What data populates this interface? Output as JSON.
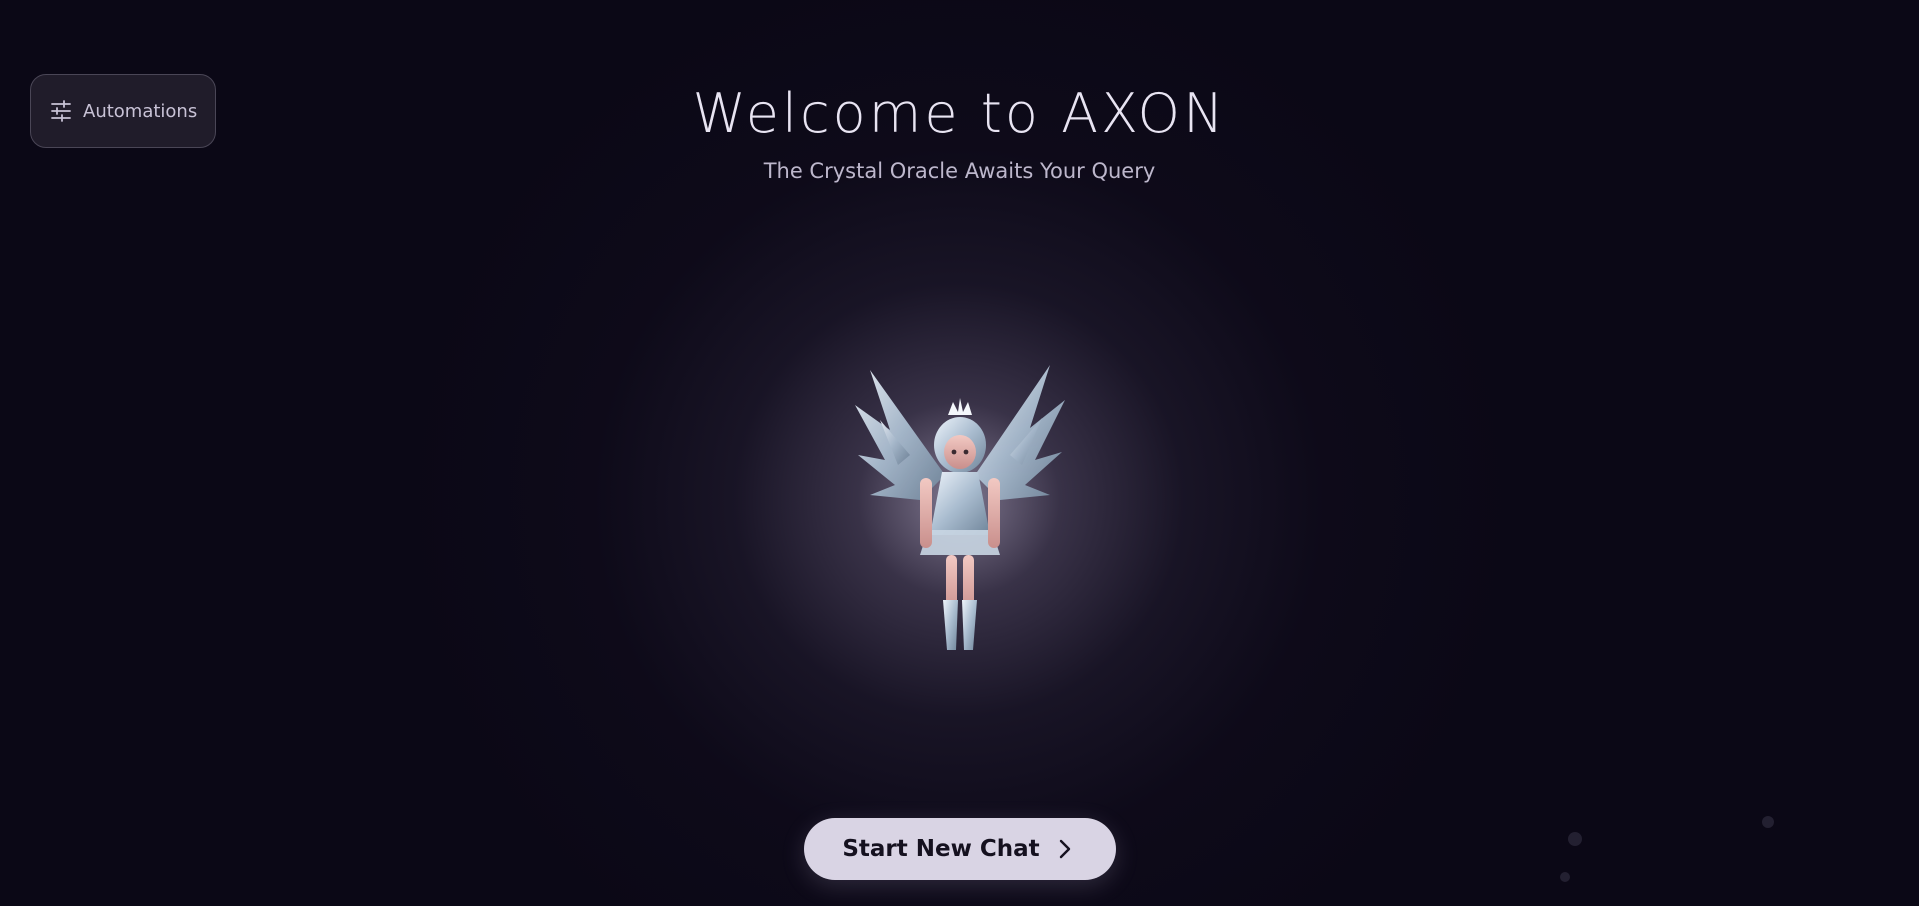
{
  "header": {
    "title": "Welcome to AXON",
    "subtitle": "The Crystal Oracle Awaits Your Query"
  },
  "automations_button": {
    "label": "Automations",
    "icon": "sliders-icon"
  },
  "hero": {
    "icon": "crystal-oracle-figure"
  },
  "start_button": {
    "label": "Start New Chat",
    "icon": "chevron-right-icon"
  },
  "colors": {
    "background": "#0b0816",
    "glow": "#c8bcda",
    "button_bg": "#d9d4e4",
    "button_text": "#15111f",
    "title_text": "#e8e4f2"
  }
}
